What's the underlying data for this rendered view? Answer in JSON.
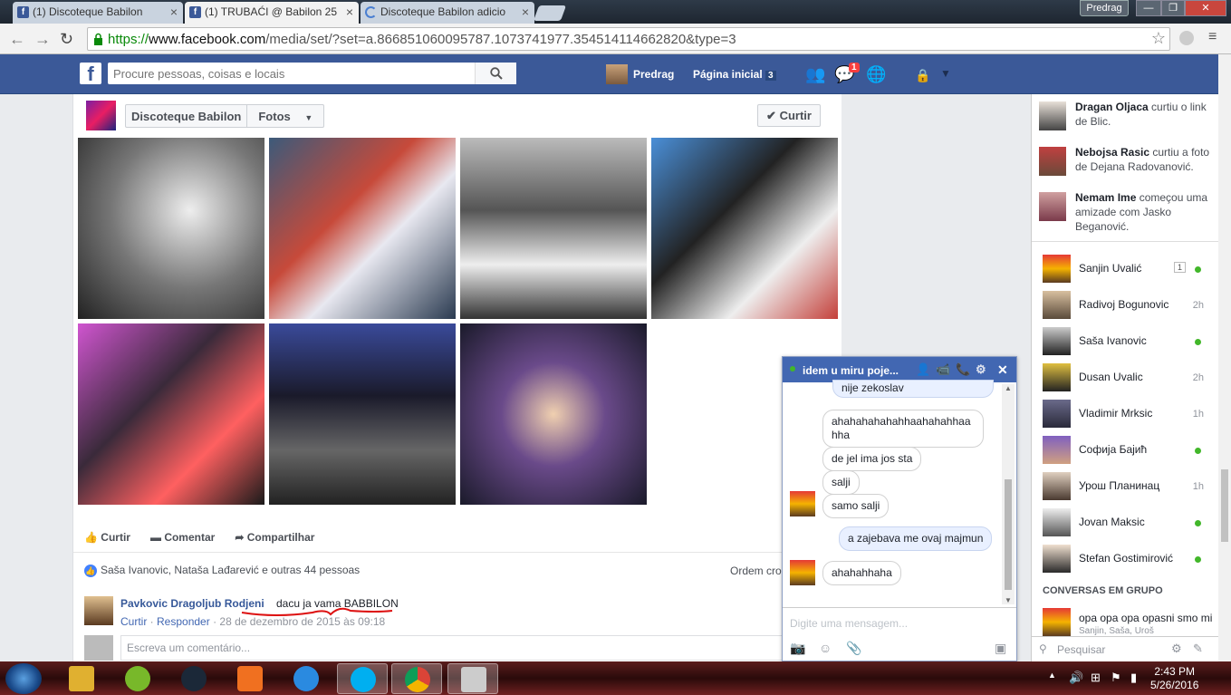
{
  "browser": {
    "tabs": [
      {
        "label": "(1) Discoteque Babilon",
        "active": false,
        "icon": "facebook-icon"
      },
      {
        "label": "(1) TRUBAĆI @ Babilon 25",
        "active": true,
        "icon": "facebook-icon"
      },
      {
        "label": "Discoteque Babilon adicio",
        "active": false,
        "icon": "loading-icon"
      }
    ],
    "user_badge": "Predrag",
    "url": {
      "scheme": "https://",
      "host": "www.facebook.com",
      "path": "/media/set/?set=a.866851060095787.1073741977.354514114662820&type=3"
    }
  },
  "fb_header": {
    "search_placeholder": "Procure pessoas, coisas e locais",
    "user_name": "Predrag",
    "home_label": "Página inicial",
    "home_count": "3",
    "messages_badge": "1"
  },
  "album": {
    "page_name": "Discoteque Babilon",
    "section": "Fotos",
    "like_button": "Curtir"
  },
  "actions": {
    "like": "Curtir",
    "comment": "Comentar",
    "share": "Compartilhar"
  },
  "likes_summary": "Saša Ivanovic, Nataša Lađarević e outras 44 pessoas",
  "order_label": "Ordem cron",
  "comment": {
    "author": "Pavkovic Dragoljub Rodjeni",
    "text": "dacu ja vama BABBILON",
    "like": "Curtir",
    "reply": "Responder",
    "date": "28 de dezembro de 2015 às 09:18"
  },
  "write_comment_placeholder": "Escreva um comentário...",
  "ticker": [
    {
      "name": "Dragan Oljaca",
      "text": " curtiu o link de Blic."
    },
    {
      "name": "Nebojsa Rasic",
      "text": " curtiu a foto de Dejana Radovanović."
    },
    {
      "name": "Nemam Ime",
      "text": " começou uma amizade com Jasko Beganović."
    }
  ],
  "contacts": [
    {
      "name": "Sanjin Uvalić",
      "badge": "1",
      "status": "online"
    },
    {
      "name": "Radivoj Bogunovic",
      "time": "2h"
    },
    {
      "name": "Saša Ivanovic",
      "status": "online"
    },
    {
      "name": "Dusan Uvalic",
      "time": "2h"
    },
    {
      "name": "Vladimir Mrksic",
      "time": "1h"
    },
    {
      "name": "Софија Бајић",
      "status": "online"
    },
    {
      "name": "Урош Планинац",
      "time": "1h"
    },
    {
      "name": "Jovan Maksic",
      "status": "online"
    },
    {
      "name": "Stefan Gostimirović",
      "status": "online"
    }
  ],
  "group_header": "CONVERSAS EM GRUPO",
  "group": {
    "title": "opa opa opa opasni smo mi",
    "members": "Sanjin, Saša, Uroš"
  },
  "ticker_search": "Pesquisar",
  "chat": {
    "title": "idem u miru poje...",
    "messages": [
      {
        "text": "nije zekoslav",
        "from": "me"
      },
      {
        "text": "ahahahahahahhaahahahhaa hha",
        "from": "other"
      },
      {
        "text": "de jel ima jos sta",
        "from": "other"
      },
      {
        "text": "salji",
        "from": "other"
      },
      {
        "text": "samo salji",
        "from": "other"
      },
      {
        "text": "a zajebava me ovaj majmun",
        "from": "me"
      },
      {
        "text": "ahahahhaha",
        "from": "other"
      }
    ],
    "input_placeholder": "Digite uma mensagem..."
  },
  "taskbar": {
    "time": "2:43 PM",
    "date": "5/26/2016"
  },
  "colors": {
    "fb_blue": "#3b5998",
    "online": "#42b72a",
    "badge_red": "#fa3e3e"
  }
}
